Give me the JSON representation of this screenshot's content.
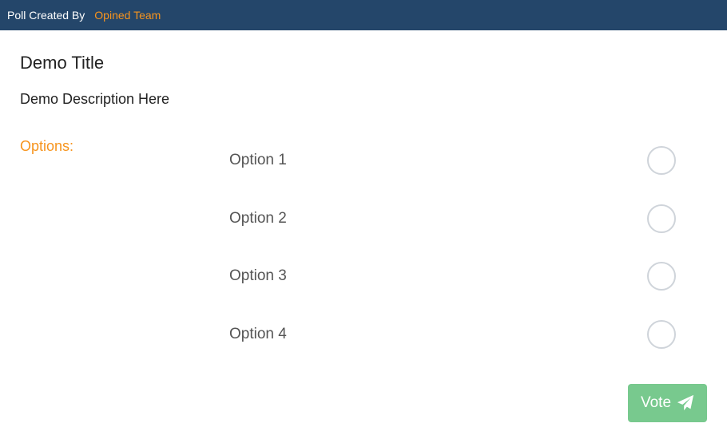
{
  "header": {
    "label": "Poll Created By",
    "author": "Opined Team",
    "background": "#24466a",
    "author_color": "#f7941d"
  },
  "poll": {
    "title": "Demo Title",
    "description": "Demo Description Here",
    "options_label": "Options:",
    "options": [
      {
        "label": "Option 1",
        "selected": false
      },
      {
        "label": "Option 2",
        "selected": false
      },
      {
        "label": "Option 3",
        "selected": false
      },
      {
        "label": "Option 4",
        "selected": false
      }
    ]
  },
  "vote_button": {
    "label": "Vote",
    "icon": "paper-plane-icon",
    "color": "#78c98e"
  }
}
